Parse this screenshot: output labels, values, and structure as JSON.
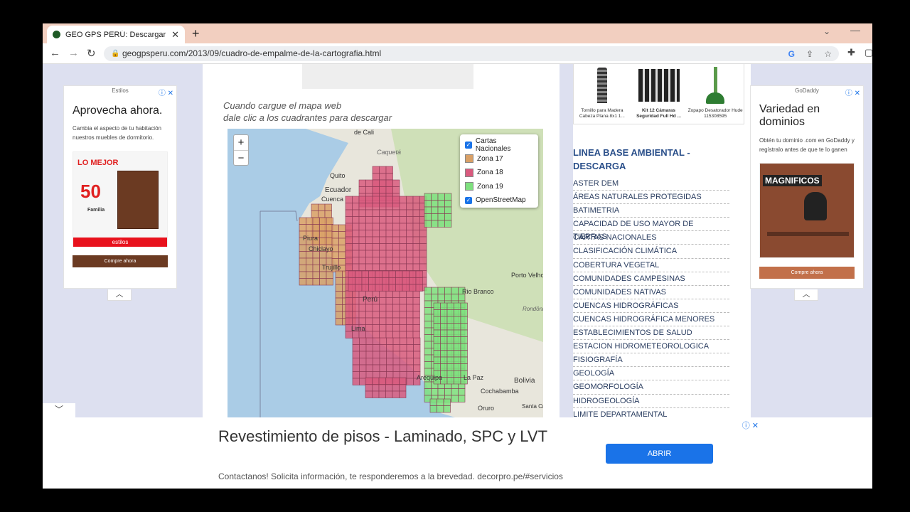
{
  "browser": {
    "tab_title": "GEO GPS PERÚ: Descargar Cartas",
    "url": "geogpsperu.com/2013/09/cuadro-de-empalme-de-la-cartografia.html"
  },
  "left_ad": {
    "header": "Estilos",
    "headline": "Aprovecha ahora.",
    "desc": "Cambia el aspecto de tu habitación nuestros muebles de dormitorio.",
    "img_top": "LO MEJOR",
    "img_num": "50",
    "img_brand": "Familia",
    "img_bar": "estilos",
    "cta": "Compre ahora"
  },
  "right_ad": {
    "header": "GoDaddy",
    "headline": "Variedad en dominios",
    "desc": "Obtén tu dominio .com en GoDaddy y regístralo antes de que te lo ganen",
    "img_text": "MAGNIFICOS",
    "cta": "Compre ahora"
  },
  "main": {
    "intro1": "Cuando cargue el mapa web",
    "intro2": "dale clic a los cuadrantes para descargar"
  },
  "map": {
    "legend": {
      "base": "Cartas Nacionales",
      "zone17": "Zona 17",
      "zone18": "Zona 18",
      "zone19": "Zona 19",
      "osm": "OpenStreetMap"
    },
    "colors": {
      "zone17": "#d9a066",
      "zone18": "#d95a7e",
      "zone19": "#7ee07e"
    },
    "places": {
      "cali": "de Cali",
      "caqueta": "Caquetá",
      "quito": "Quito",
      "ecuador": "Ecuador",
      "cuenca": "Cuenca",
      "piura": "Piura",
      "chiclayo": "Chiclayo",
      "trujillo": "Trujillo",
      "peru": "Perú",
      "lima": "Lima",
      "arequipa": "Arequipa",
      "porto_velho": "Porto Velho",
      "rio_branco": "Rio Branco",
      "rondonia": "Rondônia",
      "bolivia": "Bolivia",
      "la_paz": "La Paz",
      "cochabamba": "Cochabamba",
      "oruro": "Oruro",
      "santa_cruz": "Santa Cruz de la Si"
    }
  },
  "sidebar": {
    "products": [
      {
        "name": "Tornillo para Madera Cabeza Plana 8x1 1..."
      },
      {
        "name": "Kit 12 Cámaras Seguridad Full Hd ..."
      },
      {
        "name": "Zopapo Desatorador Hude 115308595"
      }
    ],
    "heading": "LINEA BASE AMBIENTAL - DESCARGA",
    "links": [
      "ASTER DEM",
      "ÁREAS NATURALES PROTEGIDAS",
      "BATIMETRIA",
      "CAPACIDAD DE USO MAYOR DE TIERRAS",
      "CARTAS NACIONALES",
      "CLASIFICACIÓN CLIMÁTICA",
      "COBERTURA VEGETAL",
      "COMUNIDADES CAMPESINAS",
      "COMUNIDADES NATIVAS",
      "CUENCAS HIDROGRÁFICAS",
      "CUENCAS HIDROGRÁFICA MENORES",
      "ESTABLECIMIENTOS DE SALUD",
      "ESTACION HIDROMETEOROLOGICA",
      "FISIOGRAFÍA",
      "GEOLOGÍA",
      "GEOMORFOLOGÍA",
      "HIDROGEOLOGÍA",
      "LIMITE DEPARTAMENTAL"
    ]
  },
  "bottom_ad": {
    "headline": "Revestimiento de pisos - Laminado, SPC y LVT",
    "desc": "Contactanos! Solicita información, te responderemos a la brevedad. decorpro.pe/#servicios",
    "button": "ABRIR"
  }
}
